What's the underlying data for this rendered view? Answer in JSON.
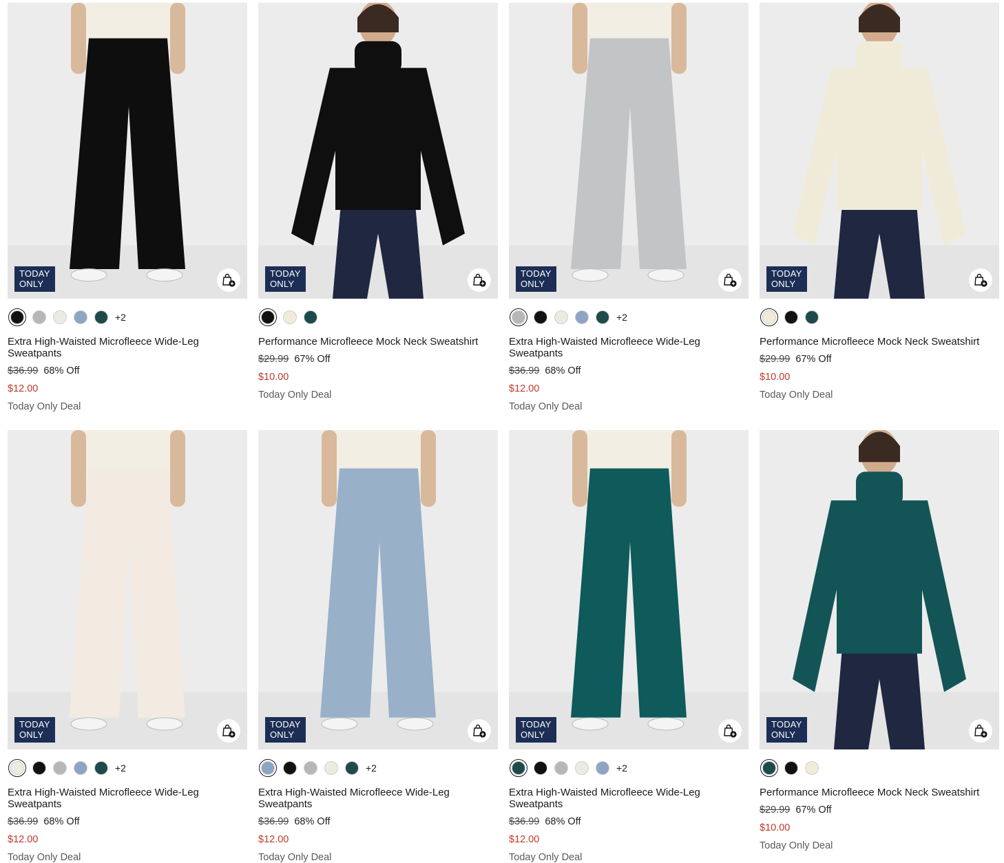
{
  "colors": {
    "badge_bg": "#1c2e55",
    "sale_red": "#c0392b"
  },
  "products": [
    {
      "name": "Extra High-Waisted Microfleece Wide-Leg Sweatpants",
      "badge": [
        "TODAY",
        "ONLY"
      ],
      "swatches": [
        "#111111",
        "#b5b7b9",
        "#ecebe1",
        "#8ea4c4",
        "#1e4a4c"
      ],
      "selected_swatch": 0,
      "more_colors": "+2",
      "original_price": "$36.99",
      "discount": "68% Off",
      "sale_price": "$12.00",
      "deal_label": "Today Only Deal",
      "garment": "pants",
      "garment_color": "#0e0e0e"
    },
    {
      "name": "Performance Microfleece Mock Neck Sweatshirt",
      "badge": [
        "TODAY",
        "ONLY"
      ],
      "swatches": [
        "#111111",
        "#f1ecd9",
        "#1e4a4c"
      ],
      "selected_swatch": 0,
      "more_colors": "",
      "original_price": "$29.99",
      "discount": "67% Off",
      "sale_price": "$10.00",
      "deal_label": "Today Only Deal",
      "garment": "sweatshirt",
      "garment_color": "#0f0f10"
    },
    {
      "name": "Extra High-Waisted Microfleece Wide-Leg Sweatpants",
      "badge": [
        "TODAY",
        "ONLY"
      ],
      "swatches": [
        "#b5b7b9",
        "#111111",
        "#ecebe1",
        "#8ea4c4",
        "#1e4a4c"
      ],
      "selected_swatch": 0,
      "more_colors": "+2",
      "original_price": "$36.99",
      "discount": "68% Off",
      "sale_price": "$12.00",
      "deal_label": "Today Only Deal",
      "garment": "pants",
      "garment_color": "#c3c4c6"
    },
    {
      "name": "Performance Microfleece Mock Neck Sweatshirt",
      "badge": [
        "TODAY",
        "ONLY"
      ],
      "swatches": [
        "#f1ecd9",
        "#111111",
        "#1e4a4c"
      ],
      "selected_swatch": 0,
      "more_colors": "",
      "original_price": "$29.99",
      "discount": "67% Off",
      "sale_price": "$10.00",
      "deal_label": "Today Only Deal",
      "garment": "sweatshirt",
      "garment_color": "#f0ebd8"
    },
    {
      "name": "Extra High-Waisted Microfleece Wide-Leg Sweatpants",
      "badge": [
        "TODAY",
        "ONLY"
      ],
      "swatches": [
        "#ecebe1",
        "#111111",
        "#b5b7b9",
        "#8ea4c4",
        "#1e4a4c"
      ],
      "selected_swatch": 0,
      "more_colors": "+2",
      "original_price": "$36.99",
      "discount": "68% Off",
      "sale_price": "$12.00",
      "deal_label": "Today Only Deal",
      "garment": "pants",
      "garment_color": "#f3ebe1"
    },
    {
      "name": "Extra High-Waisted Microfleece Wide-Leg Sweatpants",
      "badge": [
        "TODAY",
        "ONLY"
      ],
      "swatches": [
        "#8ea4c4",
        "#111111",
        "#b5b7b9",
        "#ecebe1",
        "#1e4a4c"
      ],
      "selected_swatch": 0,
      "more_colors": "+2",
      "original_price": "$36.99",
      "discount": "68% Off",
      "sale_price": "$12.00",
      "deal_label": "Today Only Deal",
      "garment": "pants",
      "garment_color": "#98b0c8"
    },
    {
      "name": "Extra High-Waisted Microfleece Wide-Leg Sweatpants",
      "badge": [
        "TODAY",
        "ONLY"
      ],
      "swatches": [
        "#1e4a4c",
        "#111111",
        "#b5b7b9",
        "#ecebe1",
        "#8ea4c4"
      ],
      "selected_swatch": 0,
      "more_colors": "+2",
      "original_price": "$36.99",
      "discount": "68% Off",
      "sale_price": "$12.00",
      "deal_label": "Today Only Deal",
      "garment": "pants",
      "garment_color": "#0f5a5a"
    },
    {
      "name": "Performance Microfleece Mock Neck Sweatshirt",
      "badge": [
        "TODAY",
        "ONLY"
      ],
      "swatches": [
        "#1e4a4c",
        "#111111",
        "#f1ecd9"
      ],
      "selected_swatch": 0,
      "more_colors": "",
      "original_price": "$29.99",
      "discount": "67% Off",
      "sale_price": "$10.00",
      "deal_label": "Today Only Deal",
      "garment": "sweatshirt",
      "garment_color": "#135556"
    }
  ]
}
